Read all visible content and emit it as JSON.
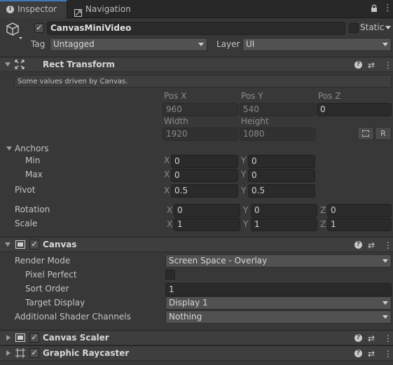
{
  "tabs": [
    {
      "label": "Inspector",
      "icon": "info-icon",
      "active": true
    },
    {
      "label": "Navigation",
      "icon": "navigation-icon",
      "active": false
    }
  ],
  "gameobject": {
    "name": "CanvasMiniVideo",
    "active": true,
    "static_label": "Static",
    "static_checked": false,
    "tag_label": "Tag",
    "tag_value": "Untagged",
    "layer_label": "Layer",
    "layer_value": "UI"
  },
  "rect_transform": {
    "title": "Rect Transform",
    "help": "Some values driven by Canvas.",
    "pos_x_label": "Pos X",
    "pos_y_label": "Pos Y",
    "pos_z_label": "Pos Z",
    "pos_x": "960",
    "pos_y": "540",
    "pos_z": "0",
    "width_label": "Width",
    "height_label": "Height",
    "width": "1920",
    "height": "1080",
    "r_button": "R",
    "anchors_label": "Anchors",
    "min_label": "Min",
    "max_label": "Max",
    "min_x": "0",
    "min_y": "0",
    "max_x": "0",
    "max_y": "0",
    "pivot_label": "Pivot",
    "pivot_x": "0.5",
    "pivot_y": "0.5",
    "rotation_label": "Rotation",
    "rot_x": "0",
    "rot_y": "0",
    "rot_z": "0",
    "scale_label": "Scale",
    "scale_x": "1",
    "scale_y": "1",
    "scale_z": "1",
    "axis_x": "X",
    "axis_y": "Y",
    "axis_z": "Z"
  },
  "canvas": {
    "title": "Canvas",
    "enabled": true,
    "render_mode_label": "Render Mode",
    "render_mode": "Screen Space - Overlay",
    "pixel_perfect_label": "Pixel Perfect",
    "pixel_perfect": false,
    "sort_order_label": "Sort Order",
    "sort_order": "1",
    "target_display_label": "Target Display",
    "target_display": "Display 1",
    "shader_channels_label": "Additional Shader Channels",
    "shader_channels": "Nothing"
  },
  "canvas_scaler": {
    "title": "Canvas Scaler",
    "enabled": true
  },
  "graphic_raycaster": {
    "title": "Graphic Raycaster",
    "enabled": true
  },
  "colors": {
    "accent": "#3a79bb",
    "panel": "#383838",
    "header": "#3e3e3e"
  }
}
